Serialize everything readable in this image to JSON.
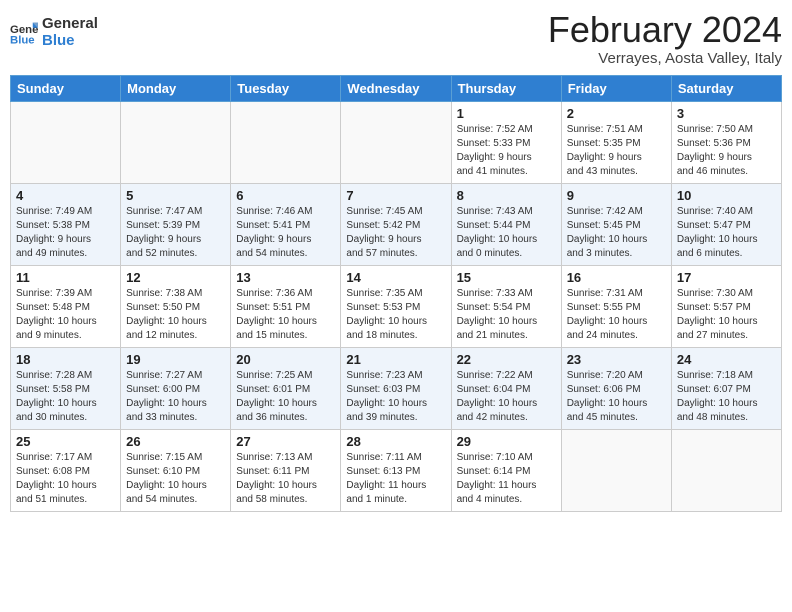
{
  "logo": {
    "line1": "General",
    "line2": "Blue"
  },
  "title": "February 2024",
  "subtitle": "Verrayes, Aosta Valley, Italy",
  "headers": [
    "Sunday",
    "Monday",
    "Tuesday",
    "Wednesday",
    "Thursday",
    "Friday",
    "Saturday"
  ],
  "rows": [
    [
      {
        "day": "",
        "info": ""
      },
      {
        "day": "",
        "info": ""
      },
      {
        "day": "",
        "info": ""
      },
      {
        "day": "",
        "info": ""
      },
      {
        "day": "1",
        "info": "Sunrise: 7:52 AM\nSunset: 5:33 PM\nDaylight: 9 hours\nand 41 minutes."
      },
      {
        "day": "2",
        "info": "Sunrise: 7:51 AM\nSunset: 5:35 PM\nDaylight: 9 hours\nand 43 minutes."
      },
      {
        "day": "3",
        "info": "Sunrise: 7:50 AM\nSunset: 5:36 PM\nDaylight: 9 hours\nand 46 minutes."
      }
    ],
    [
      {
        "day": "4",
        "info": "Sunrise: 7:49 AM\nSunset: 5:38 PM\nDaylight: 9 hours\nand 49 minutes."
      },
      {
        "day": "5",
        "info": "Sunrise: 7:47 AM\nSunset: 5:39 PM\nDaylight: 9 hours\nand 52 minutes."
      },
      {
        "day": "6",
        "info": "Sunrise: 7:46 AM\nSunset: 5:41 PM\nDaylight: 9 hours\nand 54 minutes."
      },
      {
        "day": "7",
        "info": "Sunrise: 7:45 AM\nSunset: 5:42 PM\nDaylight: 9 hours\nand 57 minutes."
      },
      {
        "day": "8",
        "info": "Sunrise: 7:43 AM\nSunset: 5:44 PM\nDaylight: 10 hours\nand 0 minutes."
      },
      {
        "day": "9",
        "info": "Sunrise: 7:42 AM\nSunset: 5:45 PM\nDaylight: 10 hours\nand 3 minutes."
      },
      {
        "day": "10",
        "info": "Sunrise: 7:40 AM\nSunset: 5:47 PM\nDaylight: 10 hours\nand 6 minutes."
      }
    ],
    [
      {
        "day": "11",
        "info": "Sunrise: 7:39 AM\nSunset: 5:48 PM\nDaylight: 10 hours\nand 9 minutes."
      },
      {
        "day": "12",
        "info": "Sunrise: 7:38 AM\nSunset: 5:50 PM\nDaylight: 10 hours\nand 12 minutes."
      },
      {
        "day": "13",
        "info": "Sunrise: 7:36 AM\nSunset: 5:51 PM\nDaylight: 10 hours\nand 15 minutes."
      },
      {
        "day": "14",
        "info": "Sunrise: 7:35 AM\nSunset: 5:53 PM\nDaylight: 10 hours\nand 18 minutes."
      },
      {
        "day": "15",
        "info": "Sunrise: 7:33 AM\nSunset: 5:54 PM\nDaylight: 10 hours\nand 21 minutes."
      },
      {
        "day": "16",
        "info": "Sunrise: 7:31 AM\nSunset: 5:55 PM\nDaylight: 10 hours\nand 24 minutes."
      },
      {
        "day": "17",
        "info": "Sunrise: 7:30 AM\nSunset: 5:57 PM\nDaylight: 10 hours\nand 27 minutes."
      }
    ],
    [
      {
        "day": "18",
        "info": "Sunrise: 7:28 AM\nSunset: 5:58 PM\nDaylight: 10 hours\nand 30 minutes."
      },
      {
        "day": "19",
        "info": "Sunrise: 7:27 AM\nSunset: 6:00 PM\nDaylight: 10 hours\nand 33 minutes."
      },
      {
        "day": "20",
        "info": "Sunrise: 7:25 AM\nSunset: 6:01 PM\nDaylight: 10 hours\nand 36 minutes."
      },
      {
        "day": "21",
        "info": "Sunrise: 7:23 AM\nSunset: 6:03 PM\nDaylight: 10 hours\nand 39 minutes."
      },
      {
        "day": "22",
        "info": "Sunrise: 7:22 AM\nSunset: 6:04 PM\nDaylight: 10 hours\nand 42 minutes."
      },
      {
        "day": "23",
        "info": "Sunrise: 7:20 AM\nSunset: 6:06 PM\nDaylight: 10 hours\nand 45 minutes."
      },
      {
        "day": "24",
        "info": "Sunrise: 7:18 AM\nSunset: 6:07 PM\nDaylight: 10 hours\nand 48 minutes."
      }
    ],
    [
      {
        "day": "25",
        "info": "Sunrise: 7:17 AM\nSunset: 6:08 PM\nDaylight: 10 hours\nand 51 minutes."
      },
      {
        "day": "26",
        "info": "Sunrise: 7:15 AM\nSunset: 6:10 PM\nDaylight: 10 hours\nand 54 minutes."
      },
      {
        "day": "27",
        "info": "Sunrise: 7:13 AM\nSunset: 6:11 PM\nDaylight: 10 hours\nand 58 minutes."
      },
      {
        "day": "28",
        "info": "Sunrise: 7:11 AM\nSunset: 6:13 PM\nDaylight: 11 hours\nand 1 minute."
      },
      {
        "day": "29",
        "info": "Sunrise: 7:10 AM\nSunset: 6:14 PM\nDaylight: 11 hours\nand 4 minutes."
      },
      {
        "day": "",
        "info": ""
      },
      {
        "day": "",
        "info": ""
      }
    ]
  ]
}
